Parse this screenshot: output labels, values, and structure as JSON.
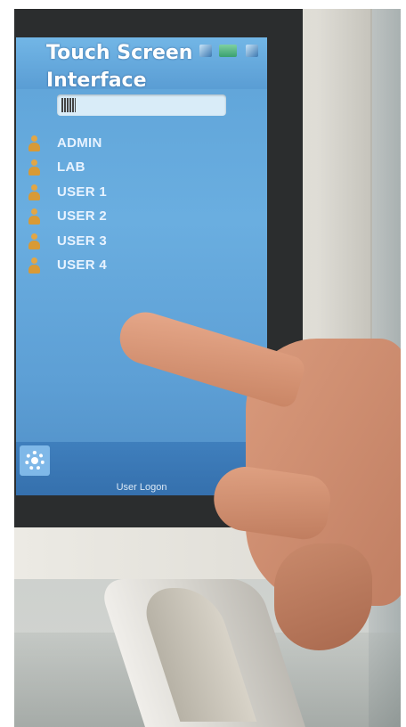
{
  "screen": {
    "title": "Touch Screen\nInterface",
    "footer_label": "User Logon",
    "status_icons": [
      "speaker-icon",
      "battery-icon",
      "speaker-icon"
    ]
  },
  "search": {
    "value": "",
    "icon": "barcode-icon"
  },
  "users": [
    {
      "label": "ADMIN",
      "icon": "user-icon"
    },
    {
      "label": "LAB",
      "icon": "user-icon"
    },
    {
      "label": "USER 1",
      "icon": "user-icon"
    },
    {
      "label": "USER 2",
      "icon": "user-icon"
    },
    {
      "label": "USER 3",
      "icon": "user-icon"
    },
    {
      "label": "USER 4",
      "icon": "user-icon"
    }
  ],
  "footer": {
    "settings_icon": "gear-icon"
  },
  "colors": {
    "screen_bg": "#6aaee0",
    "footer_bg": "#3f7fbd",
    "user_icon": "#e2a645",
    "label_text": "#e8f3ff"
  }
}
